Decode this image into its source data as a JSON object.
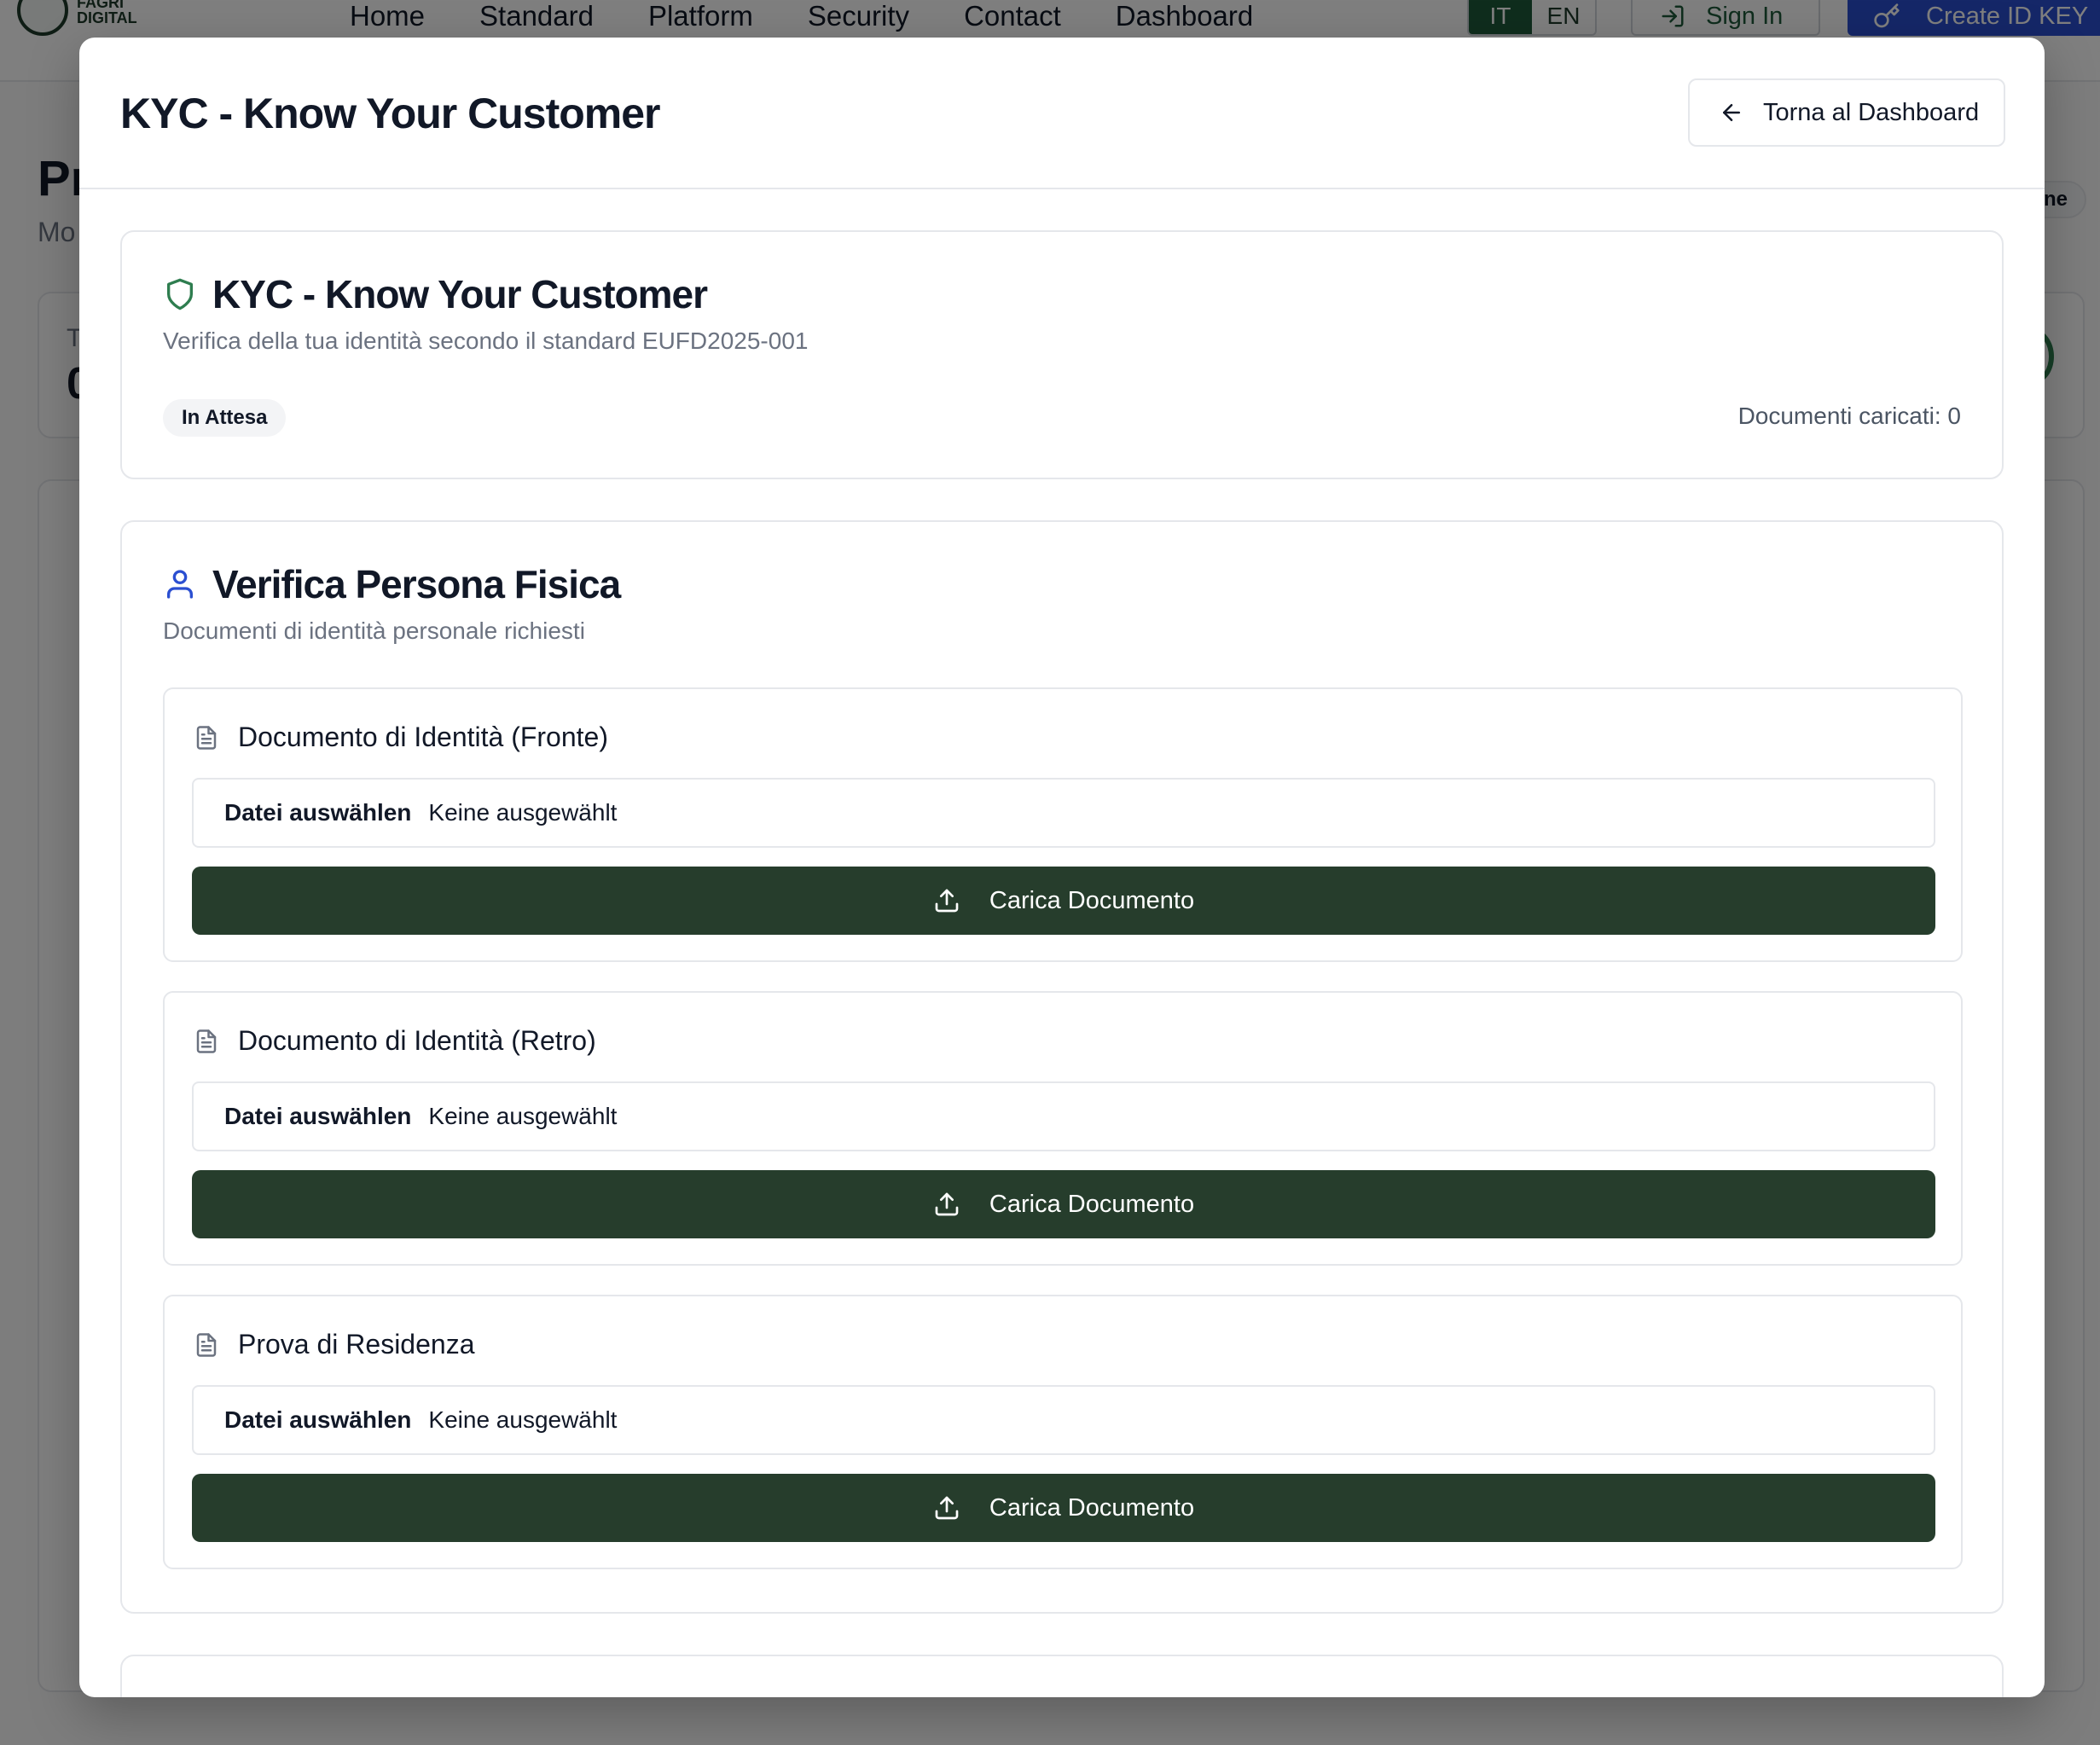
{
  "background": {
    "logo": {
      "line1": "FAGRI",
      "line2": "DIGITAL"
    },
    "nav": [
      "Home",
      "Standard",
      "Platform",
      "Security",
      "Contact",
      "Dashboard"
    ],
    "lang": {
      "it": "IT",
      "en": "EN",
      "active": "IT"
    },
    "sign_in": "Sign In",
    "create_id_key": "Create ID KEY",
    "page_title": "Pr",
    "page_subtitle": "Mo",
    "card_label": "T",
    "card_value": "0",
    "pill_text": "ne"
  },
  "modal": {
    "title": "KYC - Know Your Customer",
    "back_button": "Torna al Dashboard"
  },
  "status_card": {
    "title": "KYC - Know Your Customer",
    "description": "Verifica della tua identità secondo il standard EUFD2025-001",
    "status_badge": "In Attesa",
    "documents_uploaded": "Documenti caricati: 0"
  },
  "persona_card": {
    "title": "Verifica Persona Fisica",
    "description": "Documenti di identità personale richiesti",
    "documents": [
      {
        "label": "Documento di Identità (Fronte)",
        "choose_label": "Datei auswählen",
        "file_status": "Keine ausgewählt",
        "upload_label": "Carica Documento"
      },
      {
        "label": "Documento di Identità (Retro)",
        "choose_label": "Datei auswählen",
        "file_status": "Keine ausgewählt",
        "upload_label": "Carica Documento"
      },
      {
        "label": "Prova di Residenza",
        "choose_label": "Datei auswählen",
        "file_status": "Keine ausgewählt",
        "upload_label": "Carica Documento"
      }
    ]
  },
  "icons": {
    "back": "arrow-left-icon",
    "status": "shield-icon",
    "persona": "user-icon",
    "document": "file-text-icon",
    "upload": "upload-icon"
  },
  "colors": {
    "primary_button": "#263d2c",
    "shield": "#2e7d4f",
    "user_icon": "#2b4fd1",
    "brand_blue": "#2b4fd1",
    "lang_active": "#1f5a3a"
  }
}
